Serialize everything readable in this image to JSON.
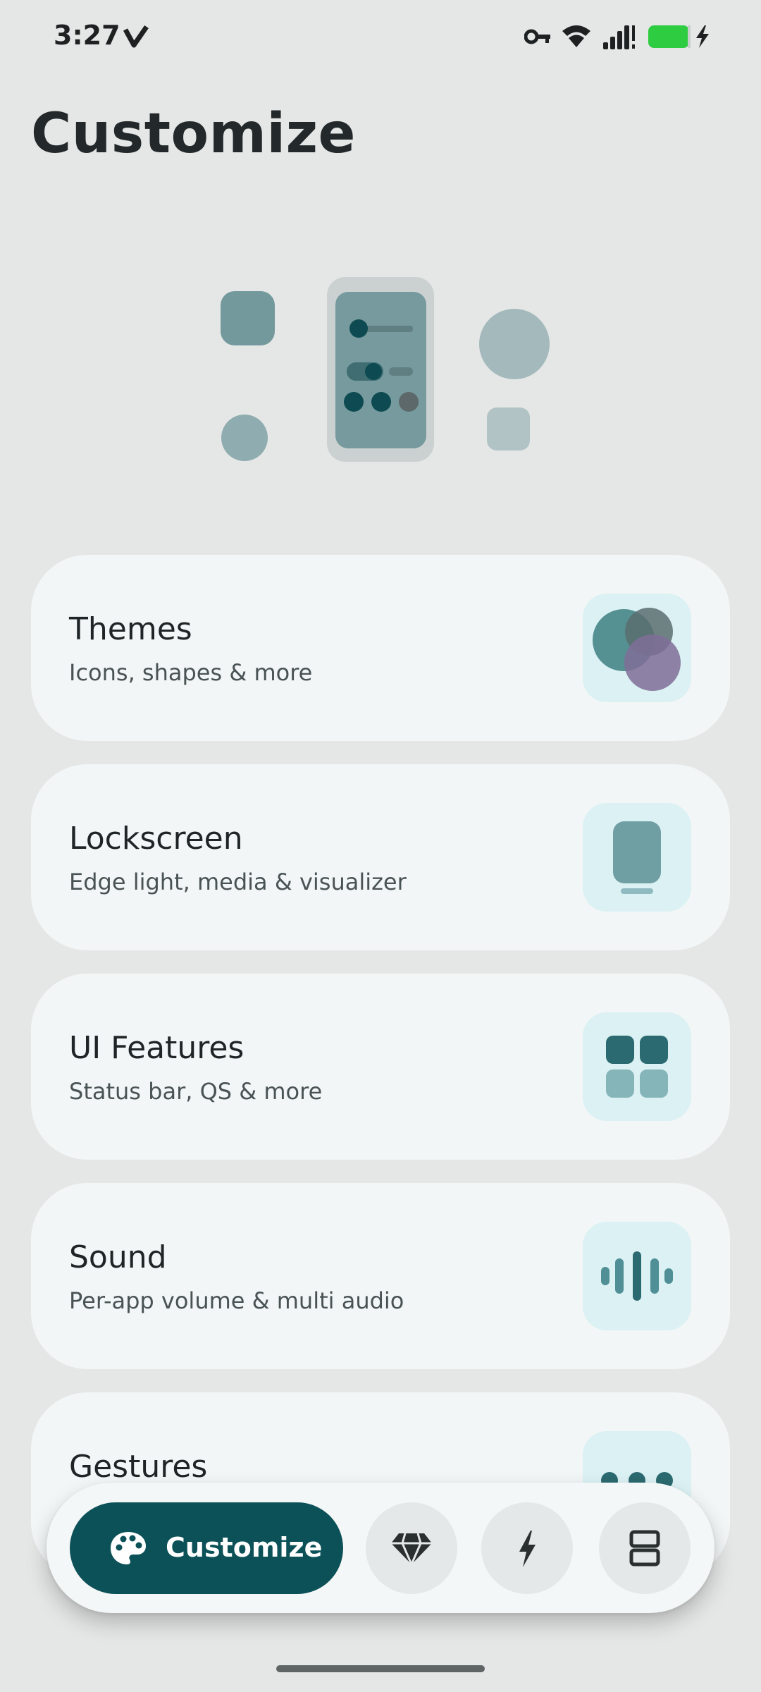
{
  "status_bar": {
    "time": "3:27",
    "icons": [
      "v-notification-icon",
      "vpn-key-icon",
      "wifi-icon",
      "signal-icon",
      "battery-charging-icon"
    ],
    "battery_color": "#2ecc40"
  },
  "page": {
    "title": "Customize"
  },
  "cards": [
    {
      "title": "Themes",
      "subtitle": "Icons, shapes & more",
      "icon": "themes-circles-icon"
    },
    {
      "title": "Lockscreen",
      "subtitle": "Edge light, media & visualizer",
      "icon": "phone-lockscreen-icon"
    },
    {
      "title": "UI Features",
      "subtitle": "Status bar, QS & more",
      "icon": "grid-tiles-icon"
    },
    {
      "title": "Sound",
      "subtitle": "Per-app volume & multi audio",
      "icon": "sound-wave-icon"
    },
    {
      "title": "Gestures",
      "subtitle": "",
      "icon": "dots-icon"
    }
  ],
  "bottom_nav": {
    "active_label": "Customize",
    "items": [
      "palette-icon",
      "diamond-icon",
      "bolt-icon",
      "layout-icon"
    ]
  },
  "colors": {
    "accent": "#0c5158",
    "card_bg": "#f2f6f6",
    "icon_box": "#dbf1f3",
    "page_bg": "#e5e7e6"
  }
}
